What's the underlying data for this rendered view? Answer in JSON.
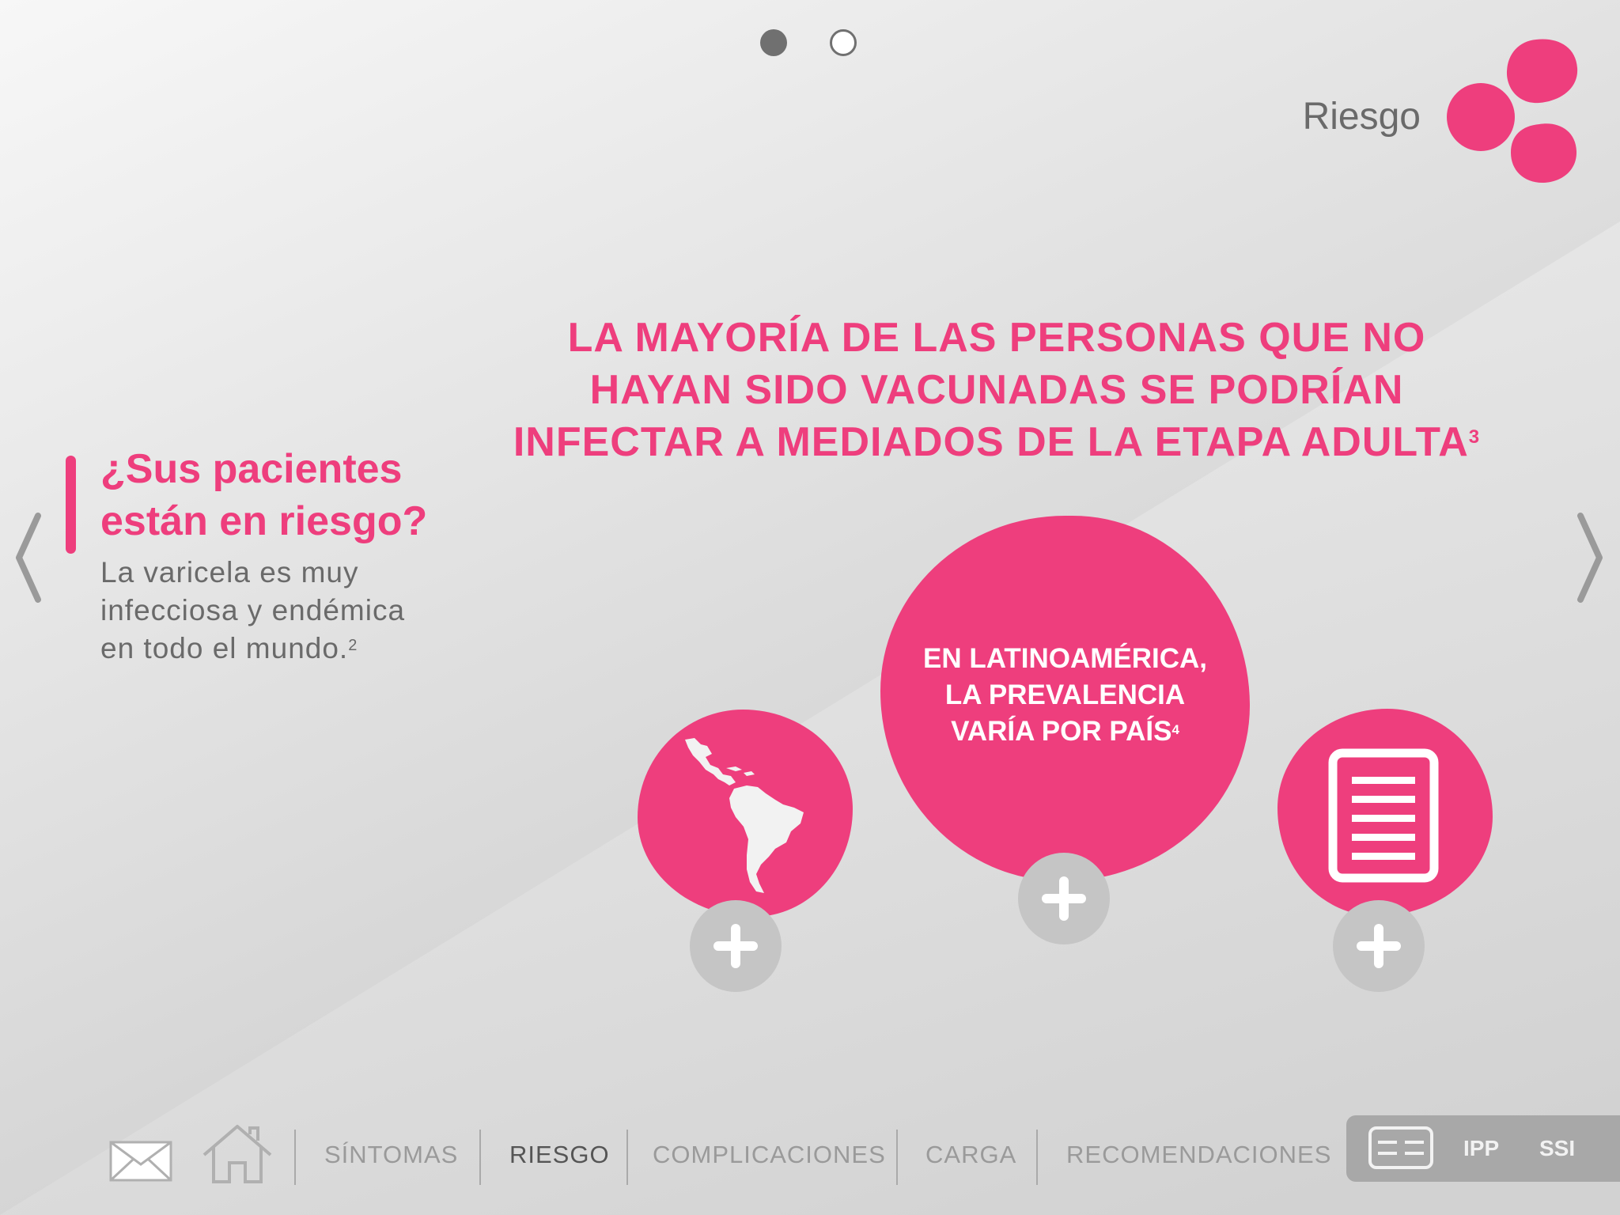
{
  "pager": {
    "dots": [
      "active",
      "inactive"
    ]
  },
  "header": {
    "section_title": "Riesgo"
  },
  "headline": {
    "lines": [
      "LA MAYORÍA DE LAS PERSONAS QUE NO",
      "HAYAN SIDO VACUNADAS SE PODRÍAN",
      "INFECTAR A MEDIADOS DE LA ETAPA ADULTA"
    ],
    "ref": "3"
  },
  "intro": {
    "question_lines": [
      "¿Sus pacientes",
      "están en riesgo?"
    ],
    "body_lines": [
      "La varicela es muy",
      "infecciosa y endémica",
      "en todo el mundo."
    ],
    "body_ref": "2"
  },
  "center_card": {
    "lines": [
      "EN LATINOAMÉRICA,",
      "LA PREVALENCIA",
      "VARÍA POR PAÍS"
    ],
    "ref": "4"
  },
  "icons": {
    "left_card": "latin-america-map-icon",
    "right_card": "document-icon",
    "expand": "plus-icon"
  },
  "nav": {
    "items": [
      "SÍNTOMAS",
      "RIESGO",
      "COMPLICACIONES",
      "CARGA",
      "RECOMENDACIONES"
    ],
    "current": "RIESGO"
  },
  "tools": {
    "ipp": "IPP",
    "ssi": "SSI"
  },
  "colors": {
    "accent": "#ee3e7d",
    "gray_text": "#6a6a6a",
    "button_gray": "#c5c5c5"
  }
}
